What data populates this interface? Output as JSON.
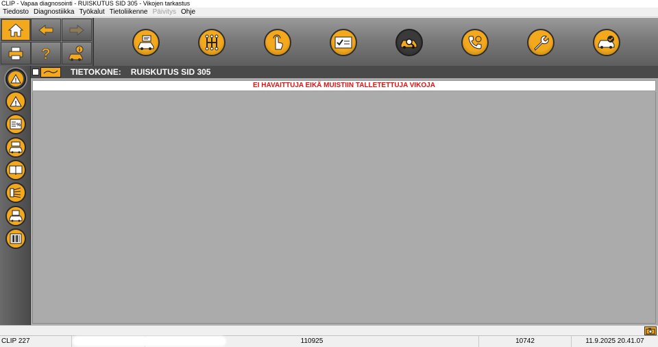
{
  "window": {
    "title": "CLIP - Vapaa diagnosointi - RUISKUTUS SID 305 - Vikojen tarkastus"
  },
  "menu": [
    {
      "label": "Tiedosto",
      "enabled": true
    },
    {
      "label": "Diagnostiikka",
      "enabled": true
    },
    {
      "label": "Työkalut",
      "enabled": true
    },
    {
      "label": "Tietoliikenne",
      "enabled": true
    },
    {
      "label": "Päivitys",
      "enabled": false
    },
    {
      "label": "Ohje",
      "enabled": true
    }
  ],
  "toolbar": {
    "left_buttons": [
      "home-icon",
      "arrow-left-icon",
      "arrow-right-icon",
      "printer-icon",
      "question-icon",
      "vehicle-info-icon"
    ],
    "main_buttons": [
      {
        "icon": "vehicle-id-icon",
        "active": false
      },
      {
        "icon": "gearbox-icon",
        "active": false
      },
      {
        "icon": "touch-icon",
        "active": false
      },
      {
        "icon": "checklist-icon",
        "active": false
      },
      {
        "icon": "vehicle-search-icon",
        "active": true
      },
      {
        "icon": "phone-support-icon",
        "active": false
      },
      {
        "icon": "wrench-icon",
        "active": false
      },
      {
        "icon": "vehicle-check-icon",
        "active": false
      }
    ]
  },
  "sidebar": [
    {
      "icon": "warning-icon",
      "active": true
    },
    {
      "icon": "warning-icon",
      "active": false
    },
    {
      "icon": "parameters-icon",
      "active": false
    },
    {
      "icon": "vehicle-config-icon",
      "active": false
    },
    {
      "icon": "manual-book-icon",
      "active": false
    },
    {
      "icon": "signals-icon",
      "active": false
    },
    {
      "icon": "vehicle-save-icon",
      "active": false
    },
    {
      "icon": "barcode-icon",
      "active": false
    }
  ],
  "content": {
    "header_label": "TIETOKONE:",
    "header_value": "RUISKUTUS SID 305",
    "message": "EI HAVAITTUJA EIKÄ MUISTIIN TALLETETTUJA VIKOJA"
  },
  "status": {
    "version": "CLIP 227",
    "code": "110925",
    "number": "10742",
    "datetime": "11.9.2025 20.41.07"
  },
  "colors": {
    "accent": "#f4a91d",
    "message": "#e21212"
  }
}
